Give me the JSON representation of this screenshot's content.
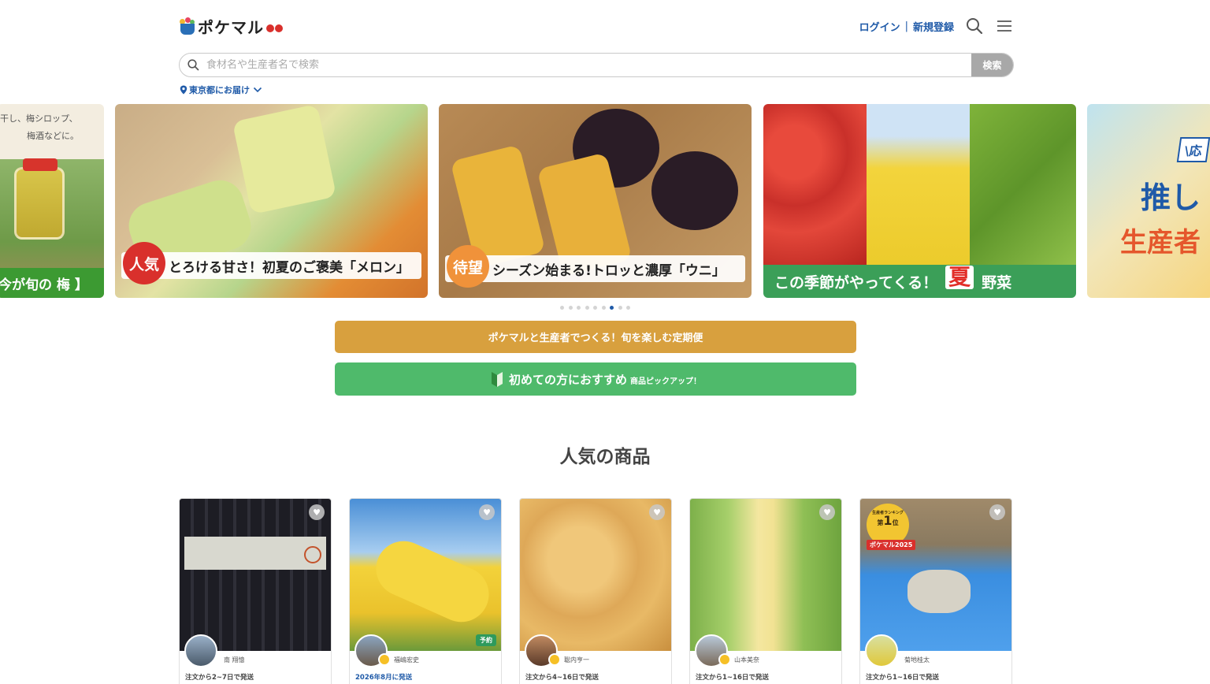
{
  "header": {
    "logo_text": "ポケマル",
    "login_label": "ログイン",
    "separator": "|",
    "register_label": "新規登録",
    "icons": [
      "search-icon",
      "menu-icon"
    ]
  },
  "search": {
    "placeholder": "食材名や生産者名で検索",
    "value": "",
    "button_label": "検索"
  },
  "delivery": {
    "label": "東京都にお届け",
    "icons": [
      "location-pin-icon",
      "chevron-down-icon"
    ]
  },
  "carousel": {
    "slides": [
      {
        "text_line1": "干し、梅シロップ、",
        "text_line2": "梅酒などに。",
        "caption": "今が旬の 梅 】"
      },
      {
        "badge": "人気",
        "caption": "とろける甘さ！初夏のご褒美「メロン」"
      },
      {
        "badge": "待望",
        "caption": "シーズン始まる!トロッと濃厚「ウニ」"
      },
      {
        "caption_a": "この季節がやってくる！",
        "caption_b": "夏",
        "caption_c": "野菜"
      },
      {
        "text_line1": "\\応",
        "text_line2": "推し",
        "text_line3": "生産者"
      }
    ],
    "dot_count": 9,
    "active_dot": 6
  },
  "banners": {
    "subscription": "ポケマルと生産者でつくる！旬を楽しむ定期便",
    "beginner_main": "初めての方におすすめ",
    "beginner_sub": "商品ピックアップ！"
  },
  "popular": {
    "title": "人気の商品",
    "products": [
      {
        "producer": "南 翔憶",
        "ship": "注文から2~7日で発送",
        "ship_highlight": false,
        "reserve": "",
        "ranking": null
      },
      {
        "producer": "福嶋宏史",
        "ship": "2026年8月に発送",
        "ship_highlight": true,
        "reserve": "予約",
        "ranking": null
      },
      {
        "producer": "聡内亨一",
        "ship": "注文から4~16日で発送",
        "ship_highlight": false,
        "reserve": "",
        "ranking": null
      },
      {
        "producer": "山本美奈",
        "ship": "注文から1~16日で発送",
        "ship_highlight": false,
        "reserve": "",
        "ranking": null
      },
      {
        "producer": "菊地桂太",
        "ship": "注文から1~16日で発送",
        "ship_highlight": false,
        "reserve": "",
        "ranking": {
          "heading": "生産者ランキング",
          "rank_prefix": "第",
          "rank_number": "1",
          "rank_suffix": "位",
          "tag": "ポケマル2025"
        }
      }
    ]
  },
  "colors": {
    "brand_blue": "#1f5aa8",
    "subscription_bg": "#d8a03e",
    "beginner_bg": "#4fba6b",
    "badge_red": "#d9302c",
    "badge_orange": "#f0923a",
    "veg_green": "#2e9a4c"
  }
}
